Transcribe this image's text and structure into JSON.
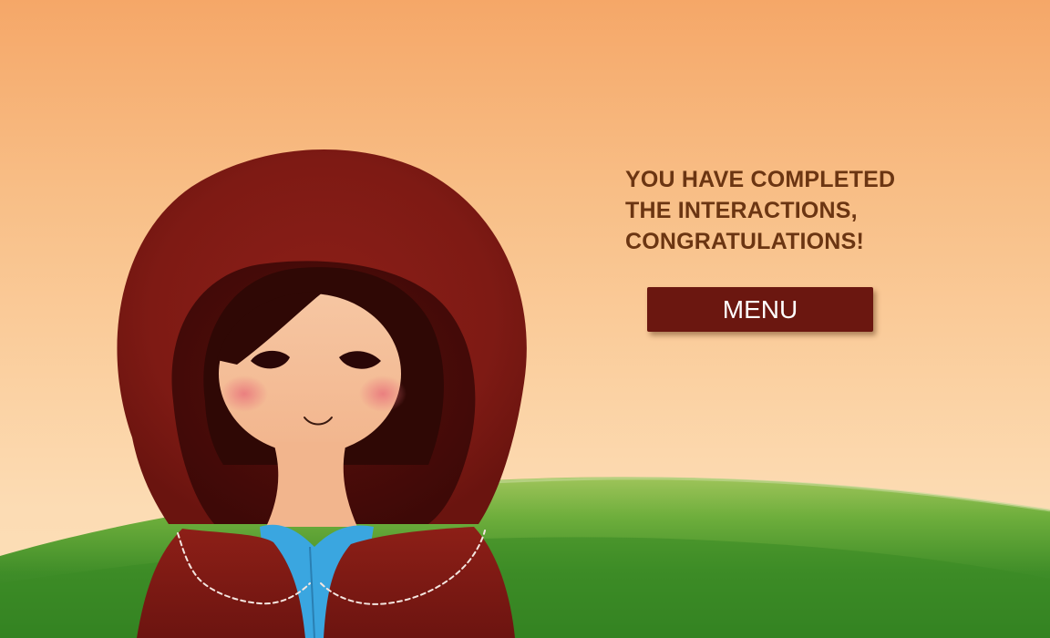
{
  "completion": {
    "message_lines": [
      "YOU HAVE COMPLETED",
      "THE INTERACTIONS,",
      "CONGRATULATIONS!"
    ],
    "menu_label": "MENU"
  },
  "colors": {
    "sky_top": "#f5a768",
    "sky_bottom": "#fde0b8",
    "grass": "#4f9a2e",
    "message_text": "#6b3512",
    "button_background": "#6b1710",
    "button_text": "#ffffff",
    "cloak": "#8a1c16",
    "dress": "#3aa6e0"
  }
}
